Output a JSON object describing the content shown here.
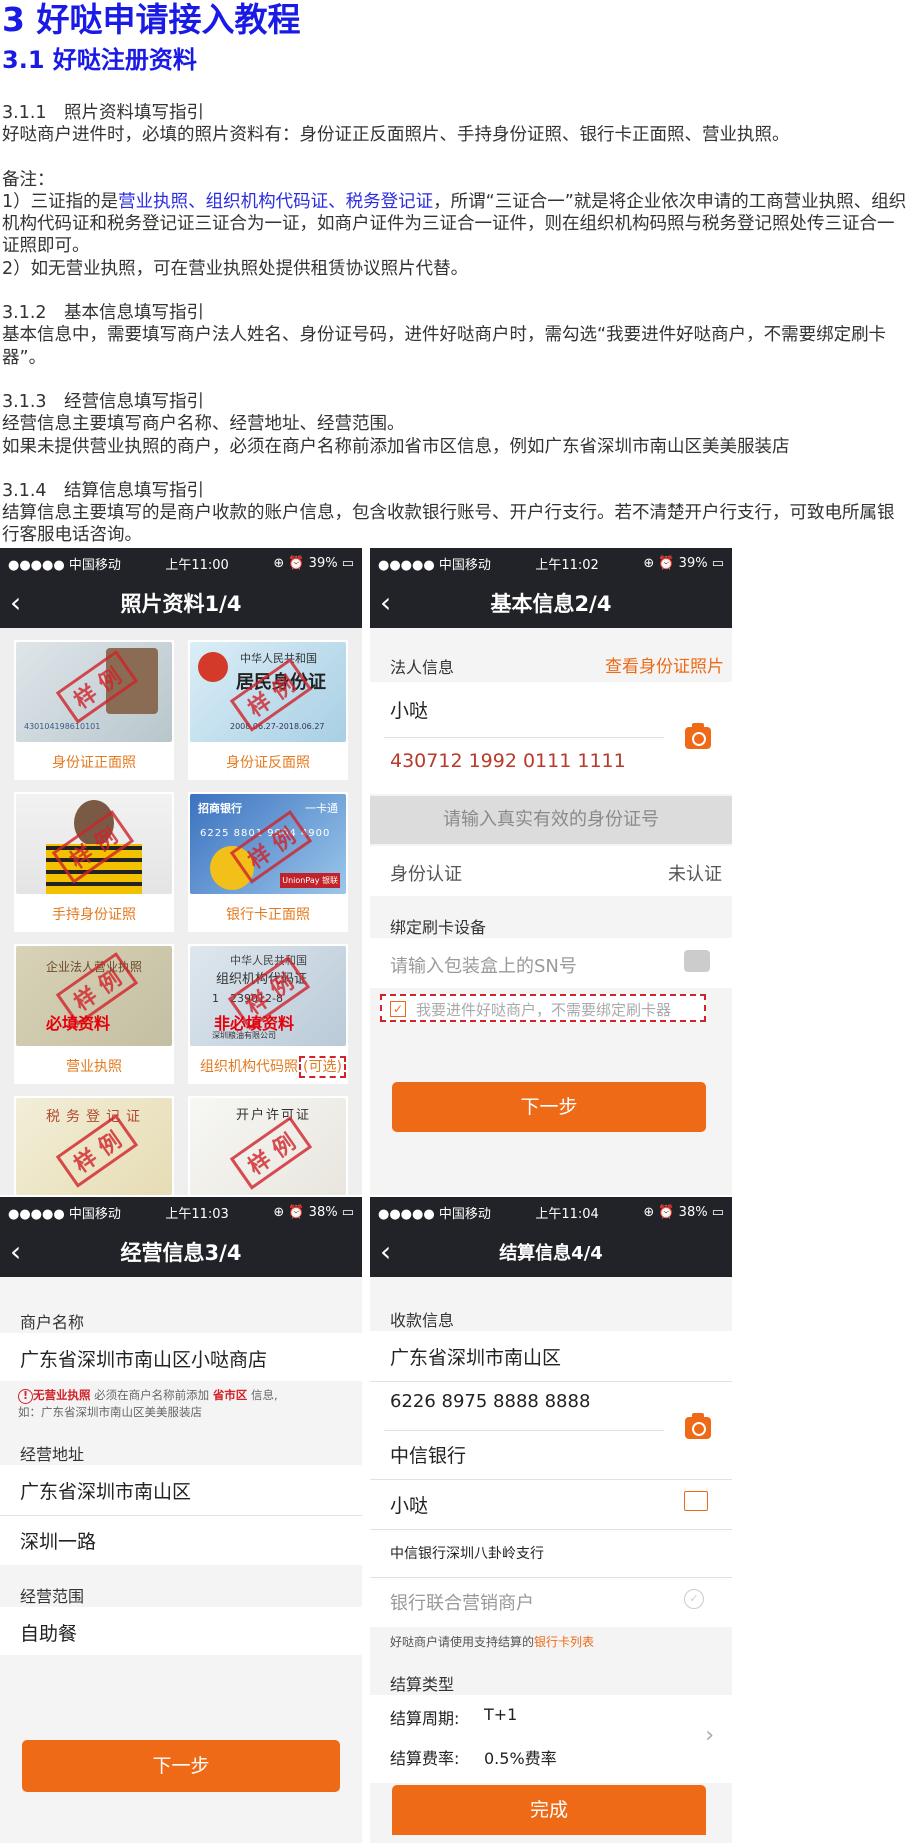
{
  "doc": {
    "h1": "3 好哒申请接入教程",
    "h2": "3.1 好哒注册资料",
    "s1_title": "3.1.1　照片资料填写指引",
    "s1_body": "好哒商户进件时，必填的照片资料有：身份证正反面照片、手持身份证照、银行卡正面照、营业执照。",
    "note_label": "备注：",
    "note1_pre": "1）三证指的是",
    "note1_blue": "营业执照、组织机构代码证、税务登记证",
    "note1_post": "，所谓“三证合一”就是将企业依次申请的工商营业执照、组织机构代码证和税务登记证三证合为一证，如商户证件为三证合一证件，则在组织机构码照与税务登记照处传三证合一证照即可。",
    "note2": "2）如无营业执照，可在营业执照处提供租赁协议照片代替。",
    "s2_title": "3.1.2　基本信息填写指引",
    "s2_body": "基本信息中，需要填写商户法人姓名、身份证号码，进件好哒商户时，需勾选“我要进件好哒商户，不需要绑定刷卡器”。",
    "s3_title": "3.1.3　经营信息填写指引",
    "s3_body1": "经营信息主要填写商户名称、经营地址、经营范围。",
    "s3_body2": "如果未提供营业执照的商户，必须在商户名称前添加省市区信息，例如广东省深圳市南山区美美服装店",
    "s4_title": "3.1.4　结算信息填写指引",
    "s4_body": "结算信息主要填写的是商户收款的账户信息，包含收款银行账号、开户行支行。若不清楚开户行支行，可致电所属银行客服电话咨询。"
  },
  "p1": {
    "status": {
      "signal": "●●●●● 中国移动",
      "time": "上午11:00",
      "battery": "39%"
    },
    "title": "照片资料1/4",
    "cards": [
      "身份证正面照",
      "身份证反面照",
      "手持身份证照",
      "银行卡正面照",
      "营业执照",
      "组织机构代码照"
    ],
    "optional": "(可选)",
    "stamp": "样 例",
    "required": "必填资料",
    "not_required": "非必填资料",
    "id_front": {
      "header": "",
      "number": "430104198610101"
    },
    "id_back": {
      "line1": "中华人民共和国",
      "line2": "居民身份证",
      "dates": "2008.06.27-2018.06.27"
    },
    "bank": {
      "brand": "招商银行",
      "type": "一卡通",
      "number": "6225 8801 9904 4900",
      "union": "UnionPay 银联"
    },
    "license": {
      "title": "企业法人营业执照"
    },
    "org": {
      "line1": "中华人民共和国",
      "line2": "组织机构代码证",
      "code": "1　239012-8",
      "company": "深圳粮油有限公司"
    },
    "tax": {
      "title": "税务登记证"
    },
    "account": {
      "title": "开户许可证"
    }
  },
  "p2": {
    "status": {
      "signal": "●●●●● 中国移动",
      "time": "上午11:02",
      "battery": "39%"
    },
    "title": "基本信息2/4",
    "section": "法人信息",
    "link": "查看身份证照片",
    "name": "小哒",
    "id": "430712 1992 0111 1111",
    "hint": "请输入真实有效的身份证号",
    "auth_label": "身份认证",
    "auth_status": "未认证",
    "device_section": "绑定刷卡设备",
    "sn_placeholder": "请输入包装盒上的SN号",
    "checkbox": "我要进件好哒商户，不需要绑定刷卡器",
    "next": "下一步"
  },
  "p3": {
    "status": {
      "signal": "●●●●● 中国移动",
      "time": "上午11:03",
      "battery": "38%"
    },
    "title": "经营信息3/4",
    "name_section": "商户名称",
    "name": "广东省深圳市南山区小哒商店",
    "tip_red": "无营业执照",
    "tip_mid": " 必须在商户名称前添加 ",
    "tip_red2": "省市区",
    "tip_end": " 信息,",
    "tip_line2": "如：广东省深圳市南山区美美服装店",
    "addr_section": "经营地址",
    "addr1": "广东省深圳市南山区",
    "addr2": "深圳一路",
    "scope_section": "经营范围",
    "scope": "自助餐",
    "next": "下一步"
  },
  "p4": {
    "status": {
      "signal": "●●●●● 中国移动",
      "time": "上午11:04",
      "battery": "38%"
    },
    "title": "结算信息4/4",
    "section": "收款信息",
    "region": "广东省深圳市南山区",
    "account": "6226 8975 8888 8888",
    "bank": "中信银行",
    "holder": "小哒",
    "branch": "中信银行深圳八卦岭支行",
    "union": "银行联合营销商户",
    "tip_pre": "好哒商户请使用支持结算的",
    "tip_link": "银行卡列表",
    "type_section": "结算类型",
    "cycle_label": "结算周期:",
    "cycle": "T+1",
    "fee_label": "结算费率:",
    "fee": "0.5%费率",
    "done": "完成"
  },
  "colors": {
    "accent": "#ee6a17",
    "heading": "#1a1ae6",
    "dark": "#222328"
  }
}
